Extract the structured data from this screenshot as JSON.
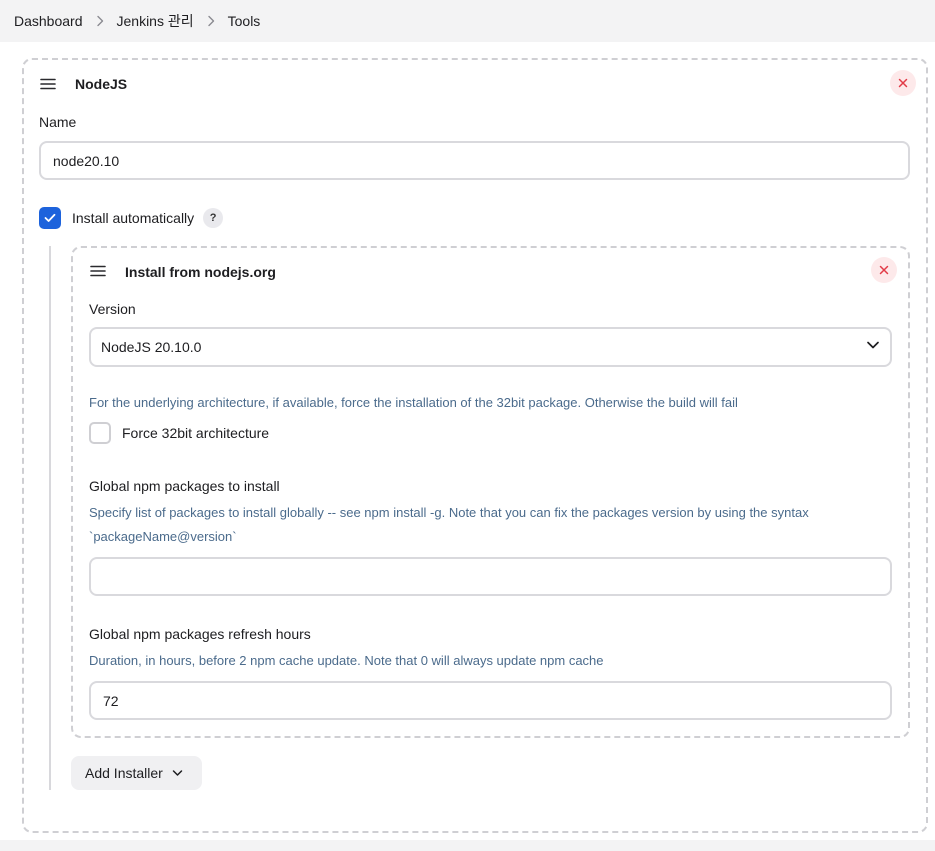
{
  "breadcrumb": {
    "items": [
      "Dashboard",
      "Jenkins 관리",
      "Tools"
    ]
  },
  "tool": {
    "title": "NodeJS",
    "name_label": "Name",
    "name_value": "node20.10",
    "install_auto_label": "Install automatically",
    "install_auto_checked": true,
    "help_label": "?",
    "installer": {
      "title": "Install from nodejs.org",
      "version_label": "Version",
      "version_value": "NodeJS 20.10.0",
      "force32_description": "For the underlying architecture, if available, force the installation of the 32bit package. Otherwise the build will fail",
      "force32_label": "Force 32bit architecture",
      "force32_checked": false,
      "npm_packages_label": "Global npm packages to install",
      "npm_packages_description": "Specify list of packages to install globally -- see npm install -g. Note that you can fix the packages version by using the syntax `packageName@version`",
      "npm_packages_value": "",
      "refresh_label": "Global npm packages refresh hours",
      "refresh_description": "Duration, in hours, before 2 npm cache update. Note that 0 will always update npm cache",
      "refresh_value": "72"
    },
    "add_installer_label": "Add Installer"
  },
  "icons": {
    "breadcrumb_separator": "chevron-right-icon",
    "drag": "drag-handle-icon",
    "delete": "close-icon",
    "checked": "check-icon",
    "help": "help-icon",
    "dropdown": "chevron-down-icon"
  },
  "colors": {
    "accent": "#1d63dc",
    "description_text": "#4b6b8c",
    "delete_background": "#fde9ea",
    "delete_icon": "#e23b47"
  }
}
